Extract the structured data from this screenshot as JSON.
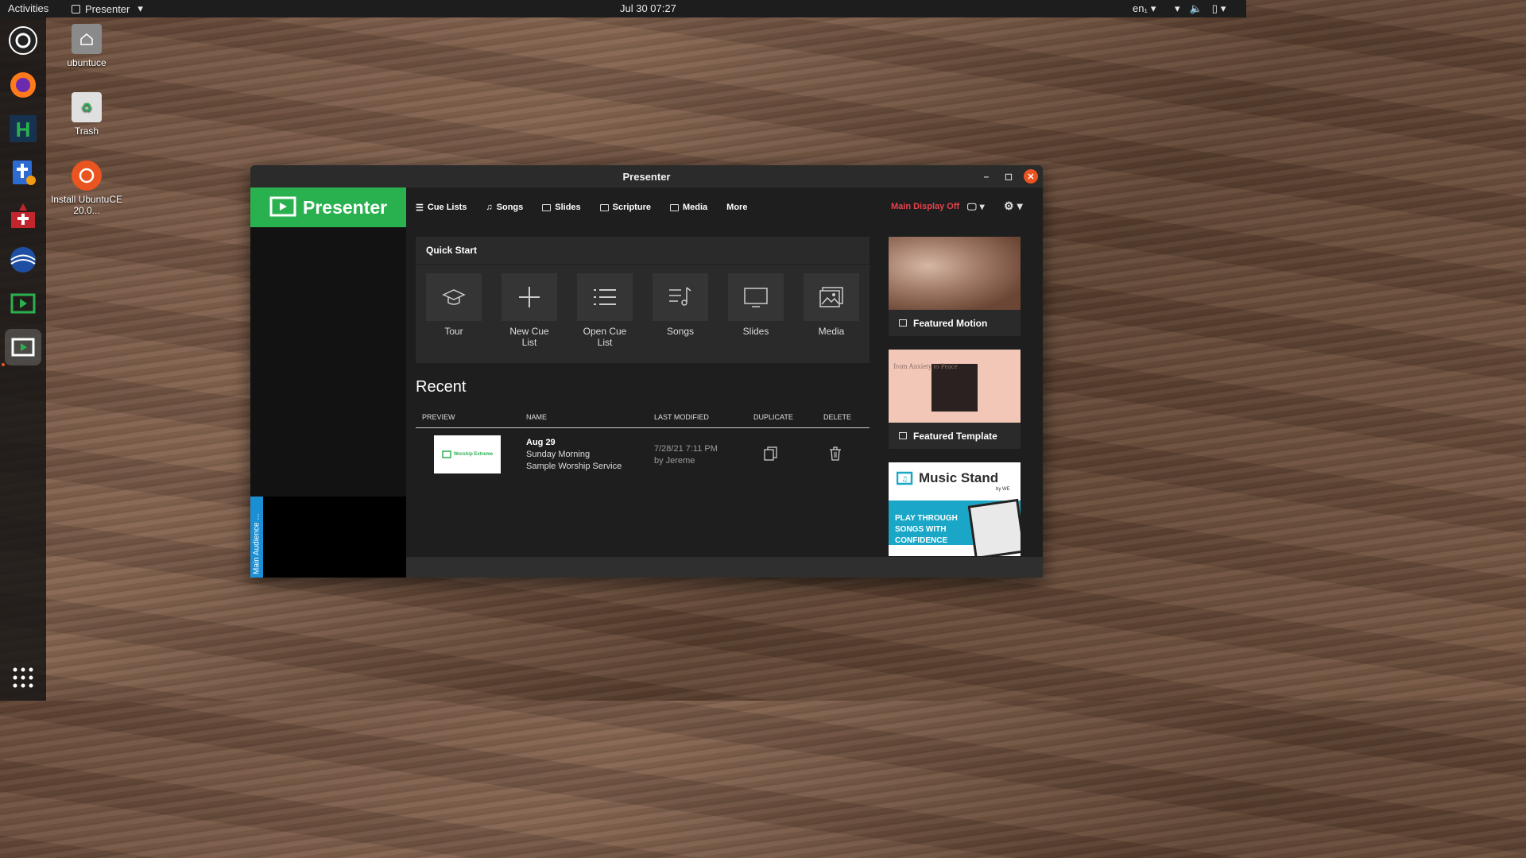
{
  "topbar": {
    "activities": "Activities",
    "app_name": "Presenter",
    "clock": "Jul 30  07:27",
    "lang": "en₁"
  },
  "desktop": {
    "icons": [
      {
        "label": "ubuntuce",
        "icon": "home-folder-icon"
      },
      {
        "label": "Trash",
        "icon": "trash-icon"
      },
      {
        "label": "Install UbuntuCE 20.0...",
        "icon": "installer-icon"
      }
    ]
  },
  "dock": {
    "items": [
      "ubuntu-icon",
      "firefox-icon",
      "h-app-icon",
      "bible-app-icon",
      "red-app-icon",
      "globe-app-icon",
      "presenter-alt-icon",
      "presenter-icon",
      "show-apps-icon"
    ]
  },
  "window": {
    "title": "Presenter",
    "logo_text": "Presenter",
    "nav": {
      "cue_lists": "Cue Lists",
      "songs": "Songs",
      "slides": "Slides",
      "scripture": "Scripture",
      "media": "Media",
      "more": "More",
      "display_status": "Main Display Off"
    },
    "quick_start": {
      "title": "Quick Start",
      "tiles": [
        {
          "label": "Tour",
          "icon": "graduation-cap-icon"
        },
        {
          "label": "New Cue List",
          "icon": "plus-icon"
        },
        {
          "label": "Open Cue List",
          "icon": "list-icon"
        },
        {
          "label": "Songs",
          "icon": "music-list-icon"
        },
        {
          "label": "Slides",
          "icon": "monitor-icon"
        },
        {
          "label": "Media",
          "icon": "image-stack-icon"
        }
      ]
    },
    "recent": {
      "title": "Recent",
      "columns": {
        "preview": "PREVIEW",
        "name": "NAME",
        "last_modified": "LAST MODIFIED",
        "duplicate": "DUPLICATE",
        "delete": "DELETE"
      },
      "rows": [
        {
          "thumb_text": "Worship Extreme",
          "date": "Aug 29",
          "line1": "Sunday Morning",
          "line2": "Sample Worship Service",
          "modified": "7/28/21 7:11 PM",
          "by": "by Jereme"
        }
      ]
    },
    "audience_tab": "Main Audience ...",
    "cards": {
      "motion": "Featured Motion",
      "template": "Featured Template",
      "template_image_text": "from Anxiety to Peace",
      "music_title": "Music Stand",
      "music_by": "by WE",
      "music_tagline": "PLAY THROUGH SONGS WITH CONFIDENCE"
    }
  }
}
